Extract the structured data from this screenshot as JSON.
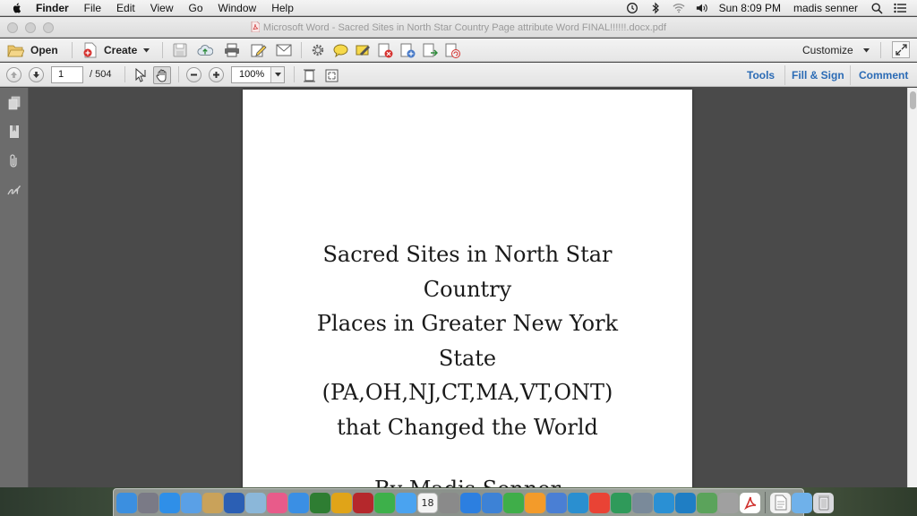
{
  "menubar": {
    "app_name": "Finder",
    "items": [
      "File",
      "Edit",
      "View",
      "Go",
      "Window",
      "Help"
    ],
    "clock": "Sun 8:09 PM",
    "user": "madis senner"
  },
  "window": {
    "title": "Microsoft Word - Sacred Sites in North Star Country Page attribute Word FINAL!!!!!!.docx.pdf"
  },
  "toolbar": {
    "open_label": "Open",
    "create_label": "Create",
    "customize_label": "Customize"
  },
  "navigation": {
    "current_page": "1",
    "total_pages": "/ 504",
    "zoom": "100%"
  },
  "panel_links": {
    "tools": "Tools",
    "fill_sign": "Fill & Sign",
    "comment": "Comment"
  },
  "document": {
    "title_lines": [
      "Sacred Sites in North Star",
      "Country",
      "Places in Greater New York",
      "State",
      "(PA,OH,NJ,CT,MA,VT,ONT)",
      "that Changed the World"
    ],
    "byline": "By Madis Senner"
  },
  "dock": {
    "calendar_day": "18",
    "items": [
      {
        "icon": "finder-icon",
        "color": "#3b8fe0"
      },
      {
        "icon": "launchpad-icon",
        "color": "#7a7a86"
      },
      {
        "icon": "safari-icon",
        "color": "#2f8fe8"
      },
      {
        "icon": "mail-icon",
        "color": "#5aa0e6"
      },
      {
        "icon": "notes-icon",
        "color": "#c9a25a"
      },
      {
        "icon": "word-icon",
        "color": "#2b5fb4"
      },
      {
        "icon": "preview-icon",
        "color": "#8bb7d9"
      },
      {
        "icon": "itunes-icon",
        "color": "#e85b8a"
      },
      {
        "icon": "app-store-icon",
        "color": "#3a8fe4"
      },
      {
        "icon": "solitaire-icon",
        "color": "#2e7d32"
      },
      {
        "icon": "opera-icon",
        "color": "#e0a418"
      },
      {
        "icon": "photo-booth-icon",
        "color": "#b5282c"
      },
      {
        "icon": "facetime-icon",
        "color": "#3db04a"
      },
      {
        "icon": "messages-icon",
        "color": "#4aa3f0"
      },
      {
        "icon": "calendar-icon",
        "color": "#f4f4f4"
      },
      {
        "icon": "system-preferences-icon",
        "color": "#8a8a8a"
      },
      {
        "icon": "safari-2-icon",
        "color": "#2c7fe0"
      },
      {
        "icon": "keynote-icon",
        "color": "#3d82d6"
      },
      {
        "icon": "numbers-icon",
        "color": "#3fae49"
      },
      {
        "icon": "pages-icon",
        "color": "#f39b2a"
      },
      {
        "icon": "keynote-2-icon",
        "color": "#4a7fd4"
      },
      {
        "icon": "ccleaner-icon",
        "color": "#2a8fd0"
      },
      {
        "icon": "chrome-icon",
        "color": "#e94335"
      },
      {
        "icon": "globe-icon",
        "color": "#2f9a5a"
      },
      {
        "icon": "image-capture-icon",
        "color": "#7a8a9a"
      },
      {
        "icon": "cyberduck-icon",
        "color": "#2a90d4"
      },
      {
        "icon": "cyberduck-2-icon",
        "color": "#1f7ec4"
      },
      {
        "icon": "contacts-icon",
        "color": "#5ba35b"
      },
      {
        "icon": "bootcamp-icon",
        "color": "#a0a0a0"
      },
      {
        "icon": "acrobat-icon",
        "color": "#ffffff"
      },
      {
        "icon": "document-icon",
        "color": "#f2f2f2"
      },
      {
        "icon": "folder-icon",
        "color": "#6fb1ea"
      },
      {
        "icon": "trash-icon",
        "color": "#d9d9dd"
      }
    ]
  }
}
